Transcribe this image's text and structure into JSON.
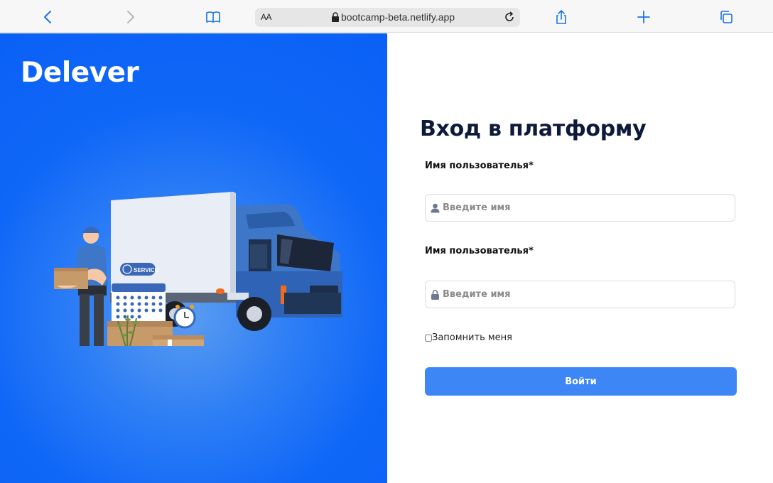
{
  "browser": {
    "text_size_label": "AA",
    "url": "bootcamp-beta.netlify.app",
    "icons": [
      "back-icon",
      "forward-icon",
      "bookmarks-icon",
      "lock-icon",
      "reload-icon",
      "share-icon",
      "new-tab-icon",
      "tabs-icon"
    ]
  },
  "hero": {
    "brand": "Delever",
    "service_badge": "SERVICE",
    "background_color": "#0a60f5"
  },
  "form": {
    "title": "Вход в платформу",
    "username_label": "Имя пользователья*",
    "username_placeholder": "Введите имя",
    "password_label": "Имя пользователья*",
    "password_placeholder": "Введите имя",
    "remember_label": "Запомнить меня",
    "submit_label": "Войти",
    "accent_color": "#3c86f5"
  }
}
